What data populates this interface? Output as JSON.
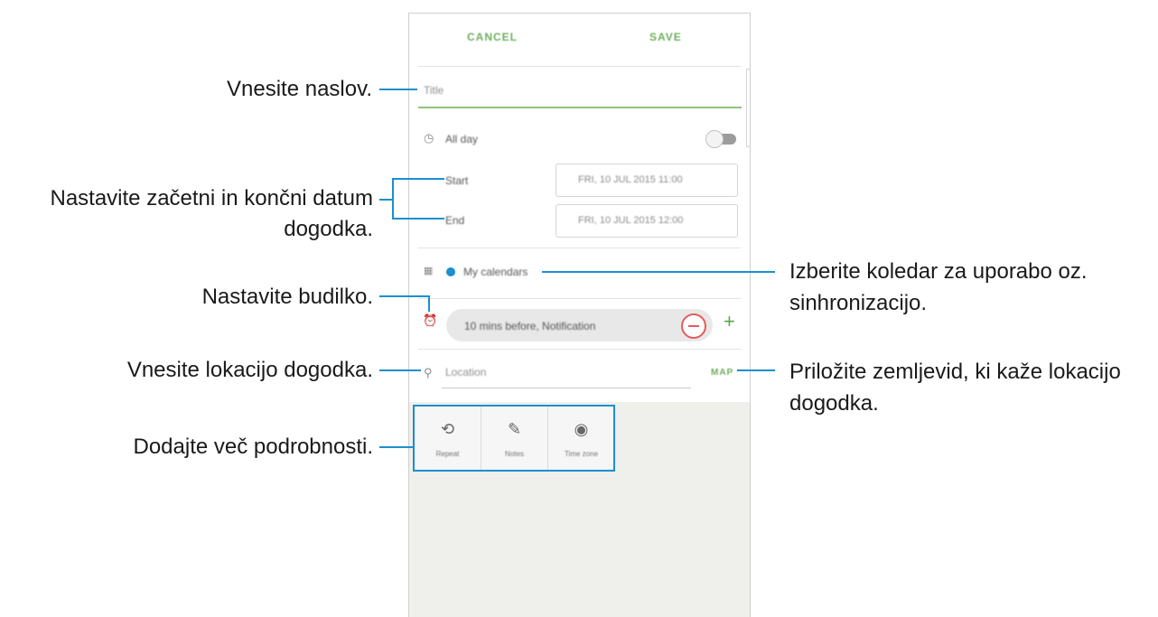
{
  "phone": {
    "cancel": "CANCEL",
    "save": "SAVE",
    "title_placeholder": "Title",
    "all_day": "All day",
    "start_label": "Start",
    "start_value": "FRI, 10 JUL 2015   11:00",
    "end_label": "End",
    "end_value": "FRI, 10 JUL 2015   12:00",
    "calendar": "My calendars",
    "calendar_color": "#1b8fd0",
    "alarm": "10 mins before, Notification",
    "location_placeholder": "Location",
    "map": "MAP",
    "tiles": [
      {
        "label": "Repeat",
        "icon": "repeat-icon"
      },
      {
        "label": "Notes",
        "icon": "notes-icon"
      },
      {
        "label": "Time zone",
        "icon": "time-zone-icon"
      }
    ]
  },
  "annotations": {
    "title": "Vnesite naslov.",
    "dates_line1": "Nastavite začetni in končni datum",
    "dates_line2": "dogodka.",
    "alarm": "Nastavite budilko.",
    "location": "Vnesite lokacijo dogodka.",
    "more": "Dodajte več podrobnosti.",
    "calendar_line1": "Izberite koledar za uporabo oz.",
    "calendar_line2": "sinhronizacijo.",
    "map_line1": "Priložite zemljevid, ki kaže lokacijo",
    "map_line2": "dogodka."
  },
  "colors": {
    "accent": "#1b8fd0",
    "green": "#6fae5f",
    "remove": "#e35b5b"
  }
}
